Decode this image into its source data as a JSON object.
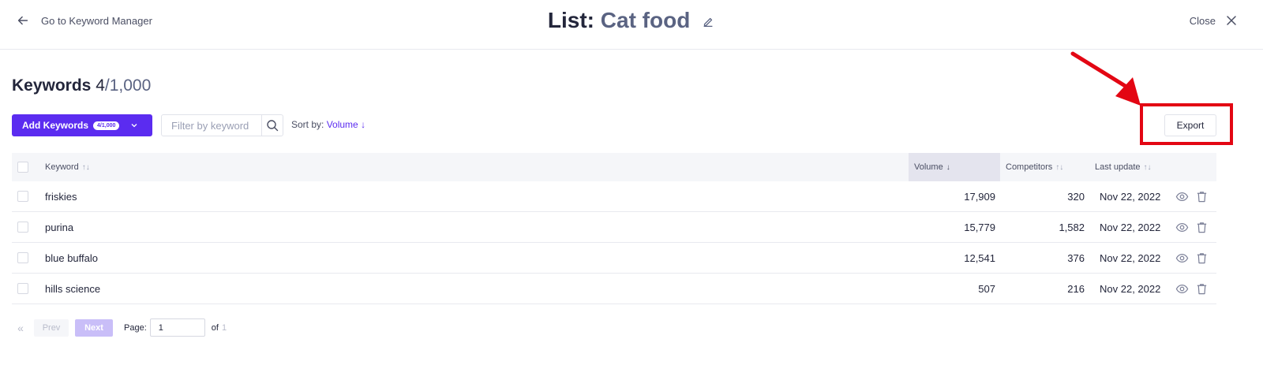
{
  "topbar": {
    "back_label": "Go to Keyword Manager",
    "title_prefix": "List:",
    "title_name": "Cat food",
    "close_label": "Close"
  },
  "heading": {
    "label": "Keywords",
    "count": "4",
    "limit": "/1,000"
  },
  "toolbar": {
    "add_label": "Add Keywords",
    "add_badge": "4/1,000",
    "filter_placeholder": "Filter by keyword",
    "sort_label": "Sort by:",
    "sort_value": "Volume ↓",
    "export_label": "Export"
  },
  "table": {
    "headers": {
      "keyword": "Keyword",
      "volume": "Volume",
      "competitors": "Competitors",
      "last_update": "Last update"
    },
    "rows": [
      {
        "keyword": "friskies",
        "volume": "17,909",
        "competitors": "320",
        "last_update": "Nov 22, 2022"
      },
      {
        "keyword": "purina",
        "volume": "15,779",
        "competitors": "1,582",
        "last_update": "Nov 22, 2022"
      },
      {
        "keyword": "blue buffalo",
        "volume": "12,541",
        "competitors": "376",
        "last_update": "Nov 22, 2022"
      },
      {
        "keyword": "hills science",
        "volume": "507",
        "competitors": "216",
        "last_update": "Nov 22, 2022"
      }
    ]
  },
  "pagination": {
    "first": "«",
    "prev": "Prev",
    "next": "Next",
    "page_label": "Page:",
    "page_value": "1",
    "of_label": "of",
    "total_pages": "1"
  },
  "colors": {
    "accent": "#5b2cf0",
    "highlight": "#e30613"
  },
  "icons": [
    "arrow-left-icon",
    "pencil-icon",
    "close-icon",
    "chevron-down-icon",
    "search-icon",
    "sort-icon",
    "eye-icon",
    "trash-icon",
    "double-chevron-left-icon"
  ]
}
